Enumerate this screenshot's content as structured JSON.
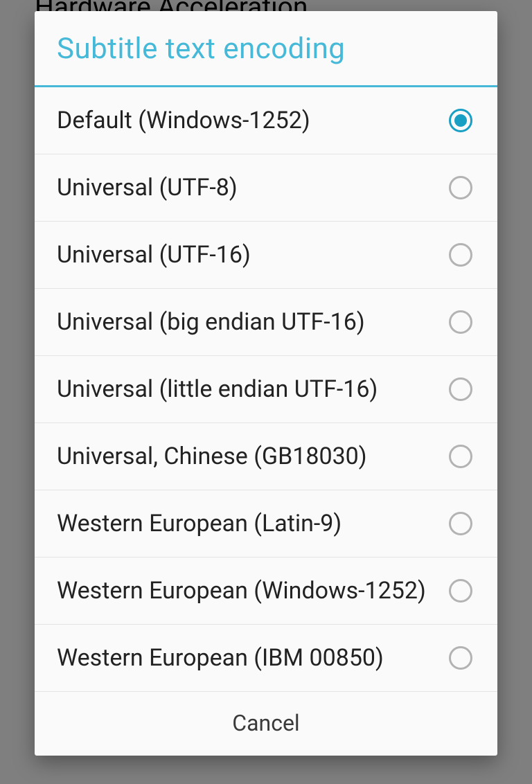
{
  "background": {
    "heading": "Hardware Acceleration"
  },
  "dialog": {
    "title": "Subtitle text encoding",
    "cancel_label": "Cancel",
    "selected_index": 0,
    "options": [
      {
        "label": "Default (Windows-1252)"
      },
      {
        "label": "Universal (UTF-8)"
      },
      {
        "label": "Universal (UTF-16)"
      },
      {
        "label": "Universal (big endian UTF-16)"
      },
      {
        "label": "Universal (little endian UTF-16)"
      },
      {
        "label": "Universal, Chinese (GB18030)"
      },
      {
        "label": "Western European (Latin-9)"
      },
      {
        "label": "Western European (Windows-1252)"
      },
      {
        "label": "Western European (IBM 00850)"
      }
    ]
  }
}
